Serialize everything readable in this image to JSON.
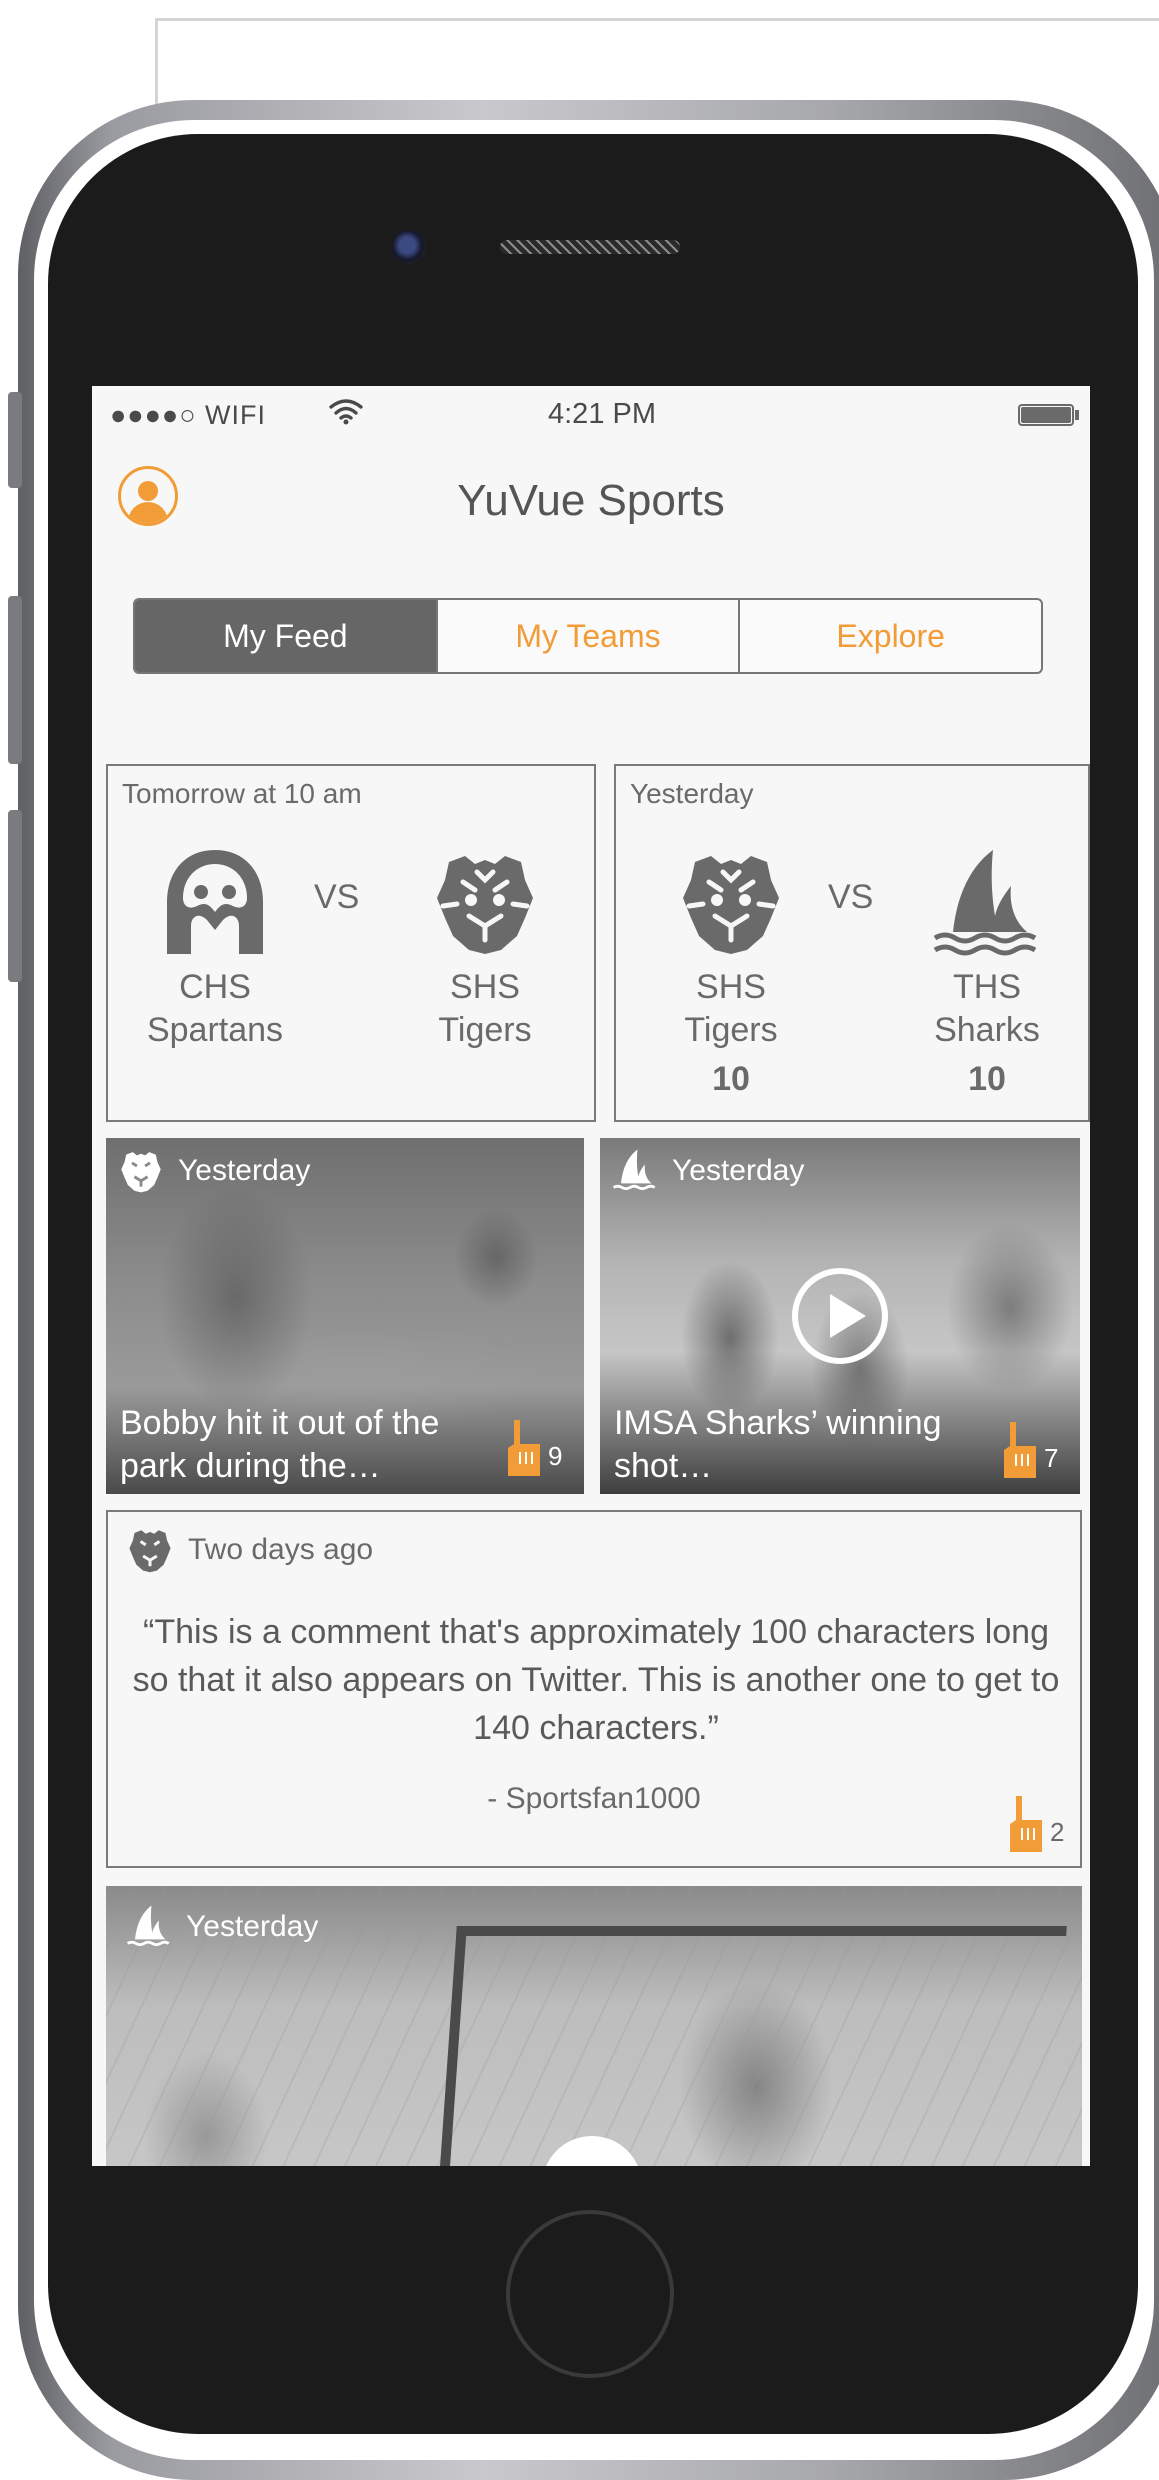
{
  "status_bar": {
    "carrier": "●●●●○ WIFI",
    "time": "4:21 PM"
  },
  "app": {
    "title": "YuVue Sports"
  },
  "tabs": [
    {
      "label": "My Feed",
      "active": true
    },
    {
      "label": "My Teams",
      "active": false
    },
    {
      "label": "Explore",
      "active": false
    }
  ],
  "games": [
    {
      "time": "Tomorrow at 10 am",
      "home": {
        "line1": "CHS",
        "line2": "Spartans",
        "icon": "spartan-helmet-icon"
      },
      "vs": "VS",
      "away": {
        "line1": "SHS",
        "line2": "Tigers",
        "icon": "tiger-icon"
      }
    },
    {
      "time": "Yesterday",
      "home": {
        "line1": "SHS",
        "line2": "Tigers",
        "score": "10",
        "icon": "tiger-icon"
      },
      "vs": "VS",
      "away": {
        "line1": "THS",
        "line2": "Sharks",
        "score": "10",
        "icon": "shark-icon"
      }
    }
  ],
  "media": [
    {
      "time": "Yesterday",
      "team_icon": "tiger-icon",
      "caption": "Bobby hit it out of the park during the…",
      "likes": "9"
    },
    {
      "time": "Yesterday",
      "team_icon": "shark-icon",
      "caption": "IMSA Sharks’ winning shot…",
      "likes": "7",
      "video": true
    }
  ],
  "comment": {
    "time": "Two days ago",
    "team_icon": "tiger-icon",
    "text": "“This is a comment that's approximately 100 characters long so that it also appears on Twitter. This is another one to get to 140 characters.”",
    "author": "- Sportsfan1000",
    "likes": "2"
  },
  "bottom_media": {
    "time": "Yesterday",
    "team_icon": "shark-icon"
  },
  "colors": {
    "accent": "#f29c38",
    "segment_active": "#666666",
    "icon_gray": "#6a6a6a"
  }
}
